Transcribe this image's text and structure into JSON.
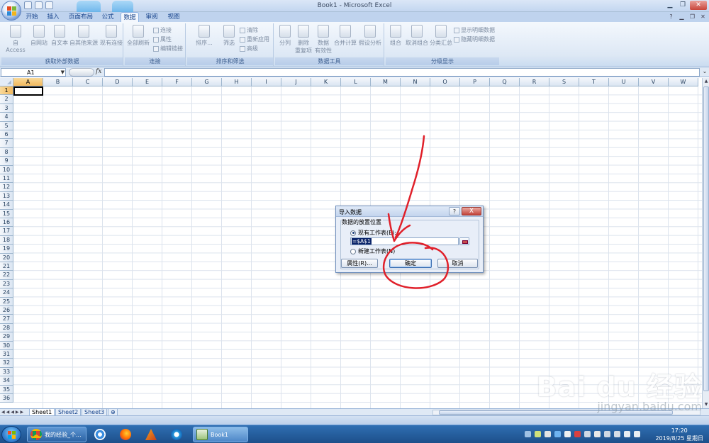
{
  "window": {
    "title": "Book1 - Microsoft Excel"
  },
  "ribbon": {
    "tabs": [
      "开始",
      "插入",
      "页面布局",
      "公式",
      "数据",
      "审阅",
      "视图"
    ],
    "active_tab": "数据",
    "groups": {
      "external": {
        "label": "获取外部数据",
        "buttons": [
          "自 Access",
          "自网站",
          "自文本",
          "自其他来源",
          "现有连接"
        ]
      },
      "connections": {
        "label": "连接",
        "big": "全部刷新",
        "small": [
          "连接",
          "属性",
          "编辑链接"
        ]
      },
      "sort": {
        "label": "排序和筛选",
        "big": [
          "排序...",
          "筛选"
        ],
        "small": [
          "清除",
          "重新应用",
          "高级"
        ]
      },
      "tools": {
        "label": "数据工具",
        "buttons": [
          "分列",
          "删除\n重复项",
          "数据\n有效性",
          "合并计算",
          "假设分析"
        ]
      },
      "outline": {
        "label": "分级显示",
        "buttons": [
          "组合",
          "取消组合",
          "分类汇总"
        ],
        "small": [
          "显示明细数据",
          "隐藏明细数据"
        ]
      }
    }
  },
  "formula_bar": {
    "name_box": "A1",
    "fx": "fx",
    "value": ""
  },
  "grid": {
    "columns": [
      "A",
      "B",
      "C",
      "D",
      "E",
      "F",
      "G",
      "H",
      "I",
      "J",
      "K",
      "L",
      "M",
      "N",
      "O",
      "P",
      "Q",
      "R",
      "S",
      "T",
      "U",
      "V",
      "W"
    ],
    "rows": [
      "1",
      "2",
      "3",
      "4",
      "5",
      "6",
      "7",
      "8",
      "9",
      "10",
      "11",
      "12",
      "13",
      "14",
      "15",
      "16",
      "17",
      "18",
      "19",
      "20",
      "21",
      "22",
      "23",
      "24",
      "25",
      "26",
      "27",
      "28",
      "29",
      "30",
      "31",
      "32",
      "33",
      "34",
      "35",
      "36"
    ],
    "selected_col": "A",
    "selected_row": "1"
  },
  "sheets": {
    "tabs": [
      "Sheet1",
      "Sheet2",
      "Sheet3"
    ],
    "active": "Sheet1"
  },
  "dialog": {
    "title": "导入数据",
    "help": "?",
    "close": "X",
    "group_label": "数据的放置位置",
    "existing_sheet": "现有工作表(E):",
    "reference": "=$A$1",
    "new_sheet": "新建工作表(N)",
    "properties_btn": "属性(R)...",
    "ok_btn": "确定",
    "cancel_btn": "取消"
  },
  "taskbar": {
    "items": [
      {
        "label": "我的经验_个..."
      },
      {
        "label": "Book1"
      }
    ],
    "time": "17:20",
    "date": "2019/8/25 星期日"
  },
  "watermark": {
    "brand": "Bai du 经验",
    "url": "jingyan.baidu.com"
  },
  "colors": {
    "accent": "#15428b",
    "annotation": "#e0202a",
    "selection": "#f1b85d"
  }
}
